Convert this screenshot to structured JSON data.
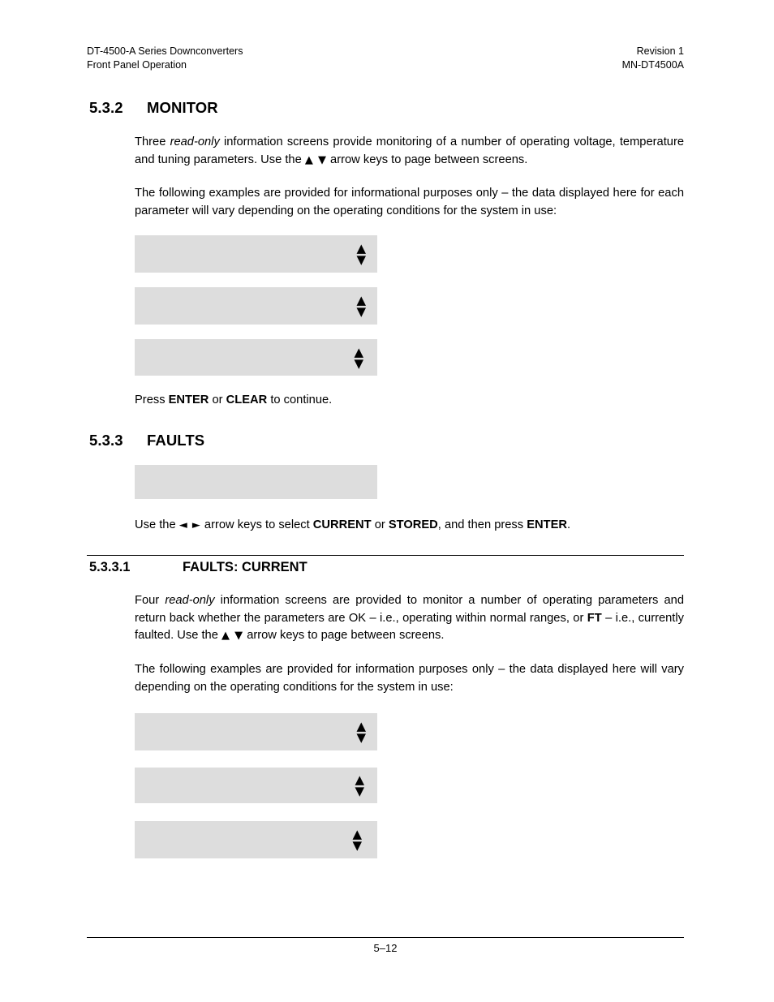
{
  "header": {
    "left_line1": "DT-4500-A Series Downconverters",
    "left_line2": "Front Panel Operation",
    "right_line1": "Revision 1",
    "right_line2": "MN-DT4500A"
  },
  "sections": {
    "monitor": {
      "number": "5.3.2",
      "title": "MONITOR",
      "para1_pre": "Three ",
      "para1_italic": "read-only",
      "para1_mid": " information screens provide monitoring of a number of operating voltage, temperature and tuning parameters. Use the ",
      "para1_arrows": "▲ ▼",
      "para1_post": " arrow keys to page between screens.",
      "para2": "The following examples are provided for informational purposes only – the data displayed here for each parameter will vary depending on the operating conditions for the system in use:",
      "press_pre": "Press ",
      "press_b1": "ENTER",
      "press_mid": " or ",
      "press_b2": "CLEAR",
      "press_post": " to continue."
    },
    "faults": {
      "number": "5.3.3",
      "title": "FAULTS",
      "use_pre": "Use the ",
      "use_arrows": "◄  ►",
      "use_mid": " arrow keys to select ",
      "use_b1": "CURRENT",
      "use_or": " or ",
      "use_b2": "STORED",
      "use_mid2": ", and then press ",
      "use_b3": "ENTER",
      "use_post": "."
    },
    "faults_current": {
      "number": "5.3.3.1",
      "title": "FAULTS: CURRENT",
      "para1_pre": "Four ",
      "para1_italic": "read-only",
      "para1_mid": " information screens are provided to monitor a number of operating parameters and return back whether the parameters are OK – i.e., operating within normal ranges, or ",
      "para1_bold": "FT",
      "para1_mid2": " – i.e., currently faulted. Use the ",
      "para1_arrows": "▲ ▼",
      "para1_post": " arrow keys to page between screens.",
      "para2": "The following examples are provided for information purposes only – the data displayed here will vary depending on the operating conditions for the system in use:"
    }
  },
  "display_boxes": {
    "up_arrow": "▲",
    "down_arrow": "▼",
    "monitor": [
      {
        "text": ""
      },
      {
        "text": ""
      },
      {
        "text": ""
      }
    ],
    "faults": [
      {
        "text": ""
      }
    ],
    "faults_current": [
      {
        "text": ""
      },
      {
        "text": ""
      },
      {
        "text": ""
      }
    ]
  },
  "footer": {
    "page_number": "5–12"
  },
  "colors": {
    "page_background": "#ffffff",
    "text": "#000000",
    "lcd_fill": "#dddddd",
    "rule": "#000000"
  }
}
